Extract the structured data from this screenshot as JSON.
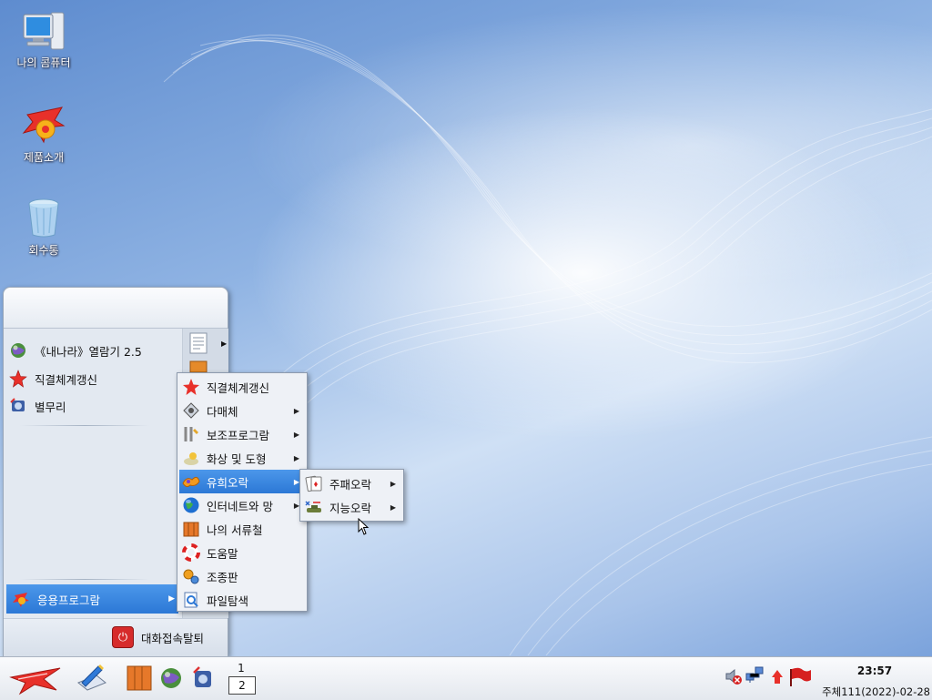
{
  "desktop": {
    "icons": [
      {
        "label": "나의 콤퓨터",
        "icon": "computer-icon"
      },
      {
        "label": "제품소개",
        "icon": "product-intro-icon"
      },
      {
        "label": "회수통",
        "icon": "recycle-bin-icon"
      }
    ]
  },
  "start_menu": {
    "favorites": [
      {
        "label": "《내나라》열람기 2.5",
        "icon": "browser-globe-icon"
      },
      {
        "label": "직결체계갱신",
        "icon": "update-star-icon"
      },
      {
        "label": "별무리",
        "icon": "byolmuri-icon"
      }
    ],
    "applications_label": "응용프로그람",
    "logout_label": "대화접속탈퇴"
  },
  "apps_submenu": {
    "items": [
      {
        "label": "직결체계갱신",
        "icon": "update-star-icon",
        "arrow": false
      },
      {
        "label": "다매체",
        "icon": "multimedia-icon",
        "arrow": true
      },
      {
        "label": "보조프로그람",
        "icon": "accessories-tools-icon",
        "arrow": true
      },
      {
        "label": "화상 및 도형",
        "icon": "graphics-icon",
        "arrow": true
      },
      {
        "label": "유희오락",
        "icon": "games-icon",
        "arrow": true,
        "highlighted": true
      },
      {
        "label": "인터네트와 망",
        "icon": "internet-globe-icon",
        "arrow": true
      },
      {
        "label": "나의 서류철",
        "icon": "my-documents-icon",
        "arrow": false
      },
      {
        "label": "도움말",
        "icon": "help-lifebuoy-icon",
        "arrow": false
      },
      {
        "label": "조종판",
        "icon": "control-panel-icon",
        "arrow": false
      },
      {
        "label": "파일탐색",
        "icon": "file-search-icon",
        "arrow": false
      }
    ]
  },
  "games_submenu": {
    "items": [
      {
        "label": "주패오락",
        "icon": "cards-icon",
        "arrow": true
      },
      {
        "label": "지능오락",
        "icon": "strategy-games-icon",
        "arrow": true
      }
    ]
  },
  "taskbar": {
    "pager": [
      "1",
      "2"
    ],
    "active_page": "2",
    "clock_time": "23:57",
    "clock_date": "주체111(2022)-02-28"
  },
  "colors": {
    "highlight": "#2c78d6",
    "desktop": "#8fb3e3",
    "red_flag": "#d62020"
  }
}
